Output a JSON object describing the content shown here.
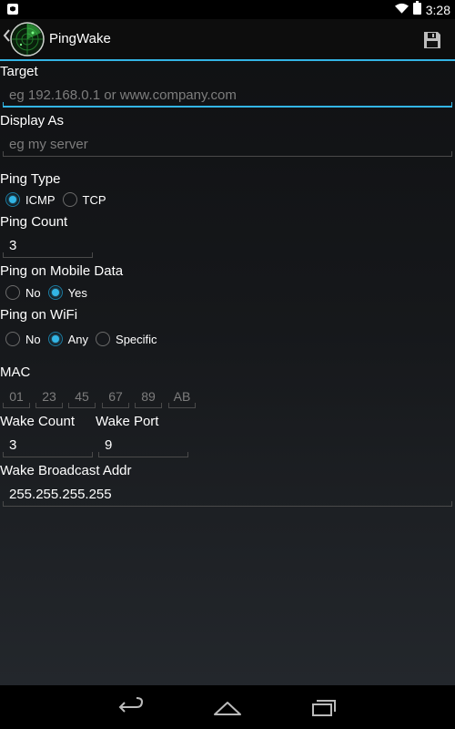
{
  "status": {
    "time": "3:28"
  },
  "app": {
    "title": "PingWake"
  },
  "form": {
    "target": {
      "label": "Target",
      "placeholder": "eg 192.168.0.1 or www.company.com"
    },
    "display_as": {
      "label": "Display As",
      "placeholder": "eg my server"
    },
    "ping_type": {
      "label": "Ping Type",
      "options": [
        "ICMP",
        "TCP"
      ],
      "selected": "ICMP"
    },
    "ping_count": {
      "label": "Ping Count",
      "value": "3"
    },
    "mobile_data": {
      "label": "Ping on Mobile Data",
      "options": [
        "No",
        "Yes"
      ],
      "selected": "Yes"
    },
    "wifi": {
      "label": "Ping on WiFi",
      "options": [
        "No",
        "Any",
        "Specific"
      ],
      "selected": "Any"
    },
    "mac": {
      "label": "MAC",
      "placeholders": [
        "01",
        "23",
        "45",
        "67",
        "89",
        "AB"
      ]
    },
    "wake_count": {
      "label": "Wake Count",
      "value": "3"
    },
    "wake_port": {
      "label": "Wake Port",
      "value": "9"
    },
    "broadcast": {
      "label": "Wake Broadcast Addr",
      "value": "255.255.255.255"
    }
  },
  "colors": {
    "accent": "#33b5e5",
    "background": "#16181b",
    "hint": "#7d7d7d"
  },
  "icons": [
    "notification-icon",
    "wifi-icon",
    "battery-icon",
    "back-caret-icon",
    "radar-app-icon",
    "save-icon",
    "nav-back-icon",
    "nav-home-icon",
    "nav-recents-icon"
  ]
}
